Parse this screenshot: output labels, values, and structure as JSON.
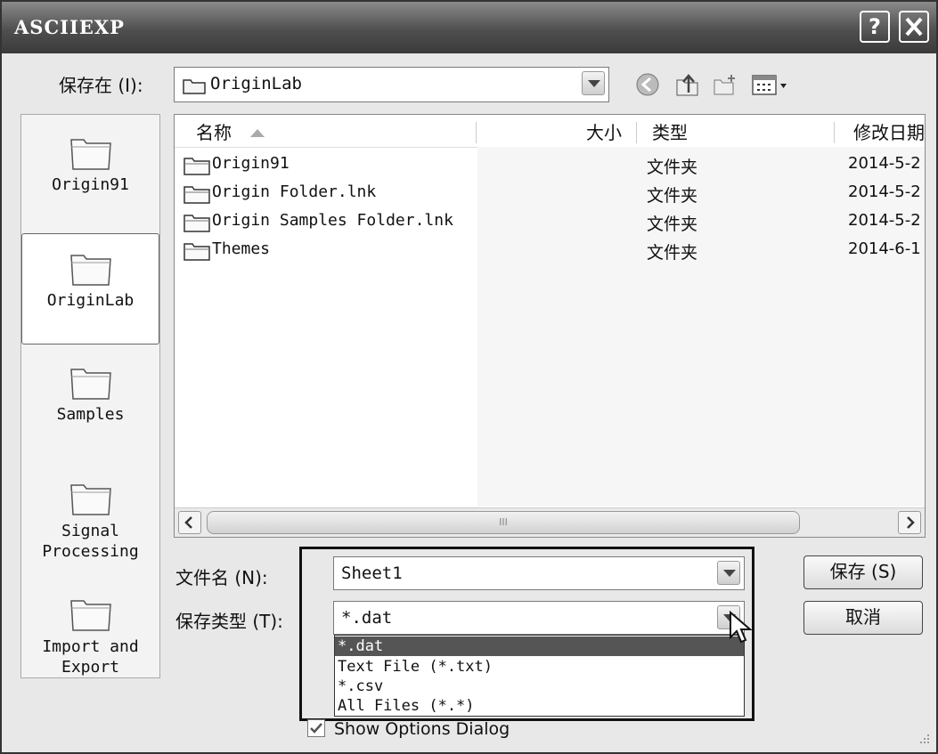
{
  "window": {
    "title": "ASCIIEXP",
    "help_label": "?",
    "close_label": "✕"
  },
  "save_in": {
    "label": "保存在 (I):",
    "value": "OriginLab"
  },
  "toolbar": {
    "icons": [
      "back-icon",
      "up-folder-icon",
      "new-folder-icon",
      "view-menu-icon"
    ]
  },
  "places": [
    {
      "label": "Origin91"
    },
    {
      "label": "OriginLab"
    },
    {
      "label": "Samples"
    },
    {
      "label": "Signal Processing"
    },
    {
      "label": "Import and Export"
    }
  ],
  "columns": {
    "name": "名称",
    "size": "大小",
    "type": "类型",
    "modified": "修改日期"
  },
  "files": [
    {
      "name": "Origin91",
      "type": "文件夹",
      "modified": "2014-5-2"
    },
    {
      "name": "Origin Folder.lnk",
      "type": "文件夹",
      "modified": "2014-5-2"
    },
    {
      "name": "Origin Samples Folder.lnk",
      "type": "文件夹",
      "modified": "2014-5-2"
    },
    {
      "name": "Themes",
      "type": "文件夹",
      "modified": "2014-6-1"
    }
  ],
  "scrollbar": {
    "grip": "III"
  },
  "filename": {
    "label": "文件名 (N):",
    "value": "Sheet1"
  },
  "filetype": {
    "label": "保存类型 (T):",
    "value": "*.dat",
    "options": [
      "*.dat",
      "Text File (*.txt)",
      "*.csv",
      "All Files (*.*)"
    ]
  },
  "buttons": {
    "save": "保存 (S)",
    "cancel": "取消"
  },
  "show_options": {
    "label": "Show Options Dialog",
    "checked": true
  }
}
